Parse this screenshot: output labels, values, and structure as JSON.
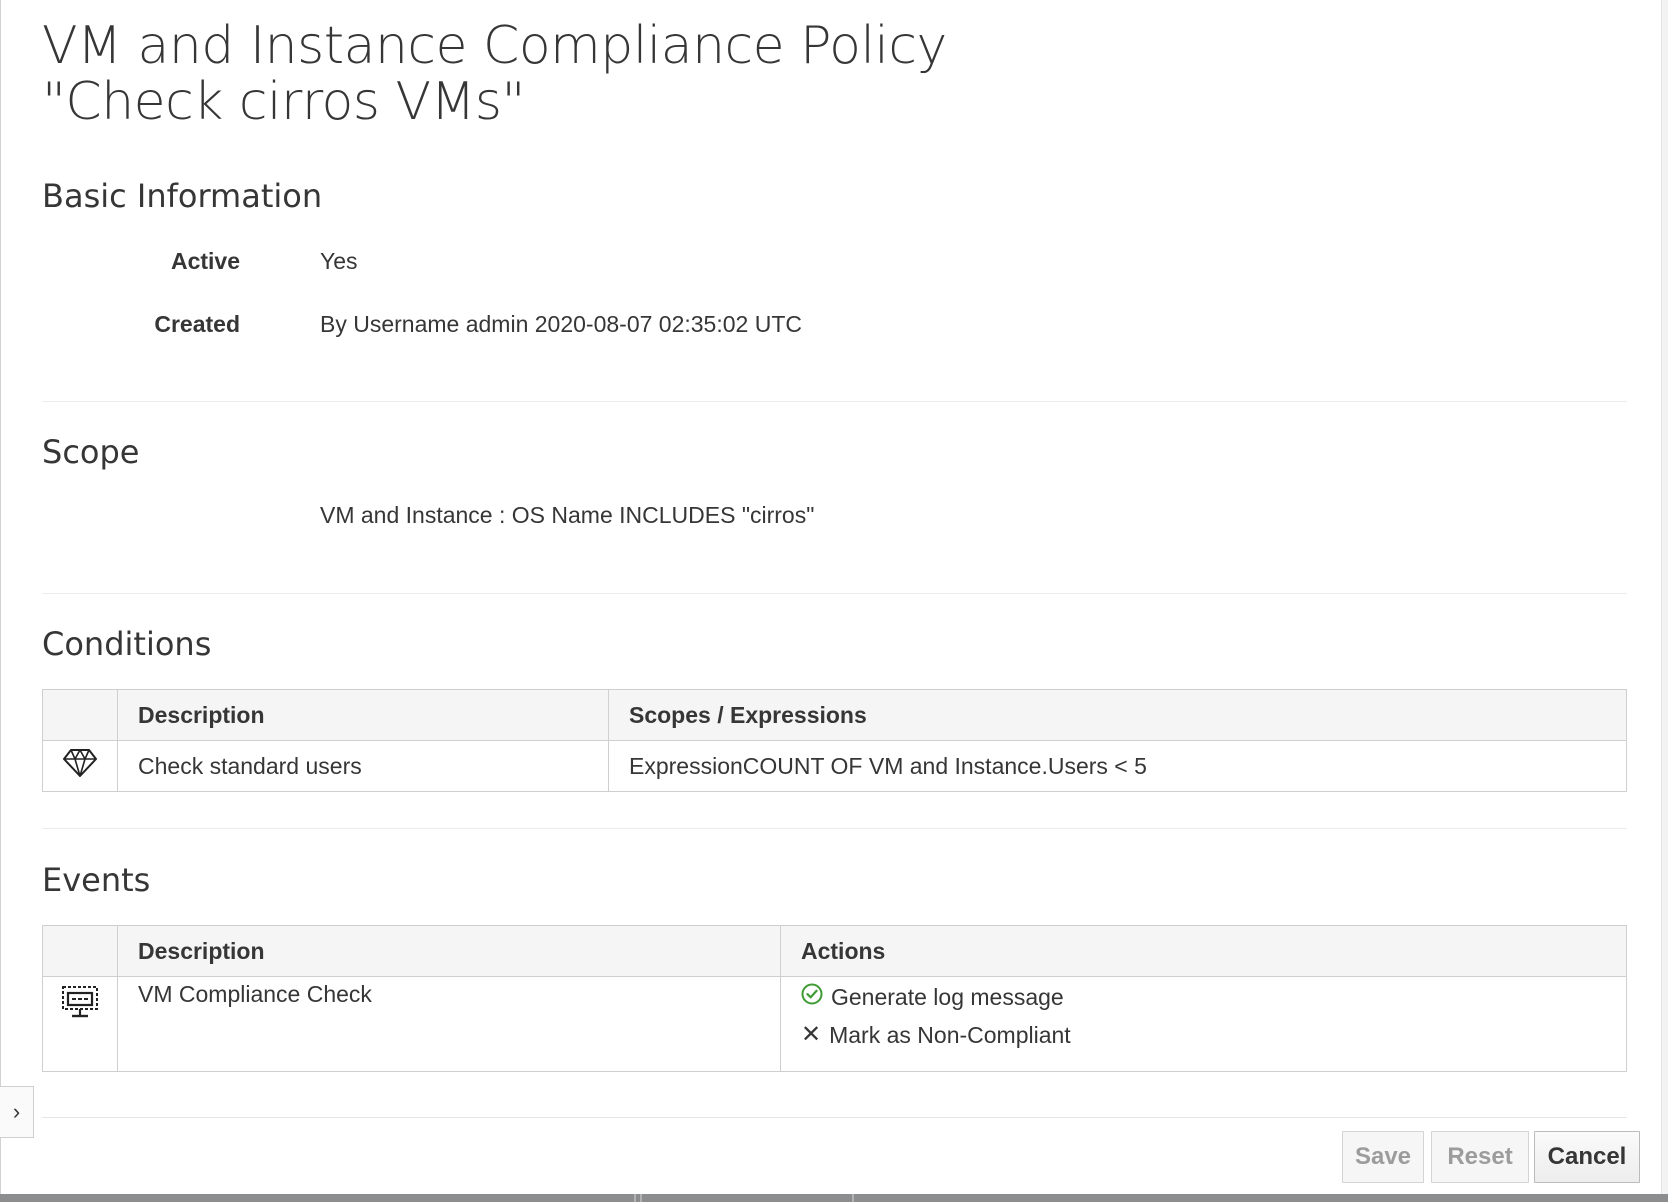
{
  "page": {
    "title_line1": "VM and Instance Compliance Policy",
    "title_line2": "\"Check cirros VMs\""
  },
  "basic_info": {
    "heading": "Basic Information",
    "active_label": "Active",
    "active_value": "Yes",
    "created_label": "Created",
    "created_value": "By Username admin 2020-08-07 02:35:02 UTC"
  },
  "scope": {
    "heading": "Scope",
    "expression": "VM and Instance : OS Name INCLUDES \"cirros\""
  },
  "conditions": {
    "heading": "Conditions",
    "columns": [
      "Description",
      "Scopes / Expressions"
    ],
    "rows": [
      {
        "icon": "diamond-icon",
        "description": "Check standard users",
        "expression": "ExpressionCOUNT OF VM and Instance.Users < 5"
      }
    ]
  },
  "events": {
    "heading": "Events",
    "columns": [
      "Description",
      "Actions"
    ],
    "rows": [
      {
        "icon": "monitor-event-icon",
        "description": "VM Compliance Check",
        "actions": [
          {
            "icon": "check-circle-icon",
            "label": "Generate log message",
            "color": "#3f9c35"
          },
          {
            "icon": "x-icon",
            "label": "Mark as Non-Compliant",
            "color": "#363636"
          }
        ]
      }
    ]
  },
  "buttons": {
    "save": "Save",
    "reset": "Reset",
    "cancel": "Cancel"
  },
  "sidebar_toggle": "›"
}
